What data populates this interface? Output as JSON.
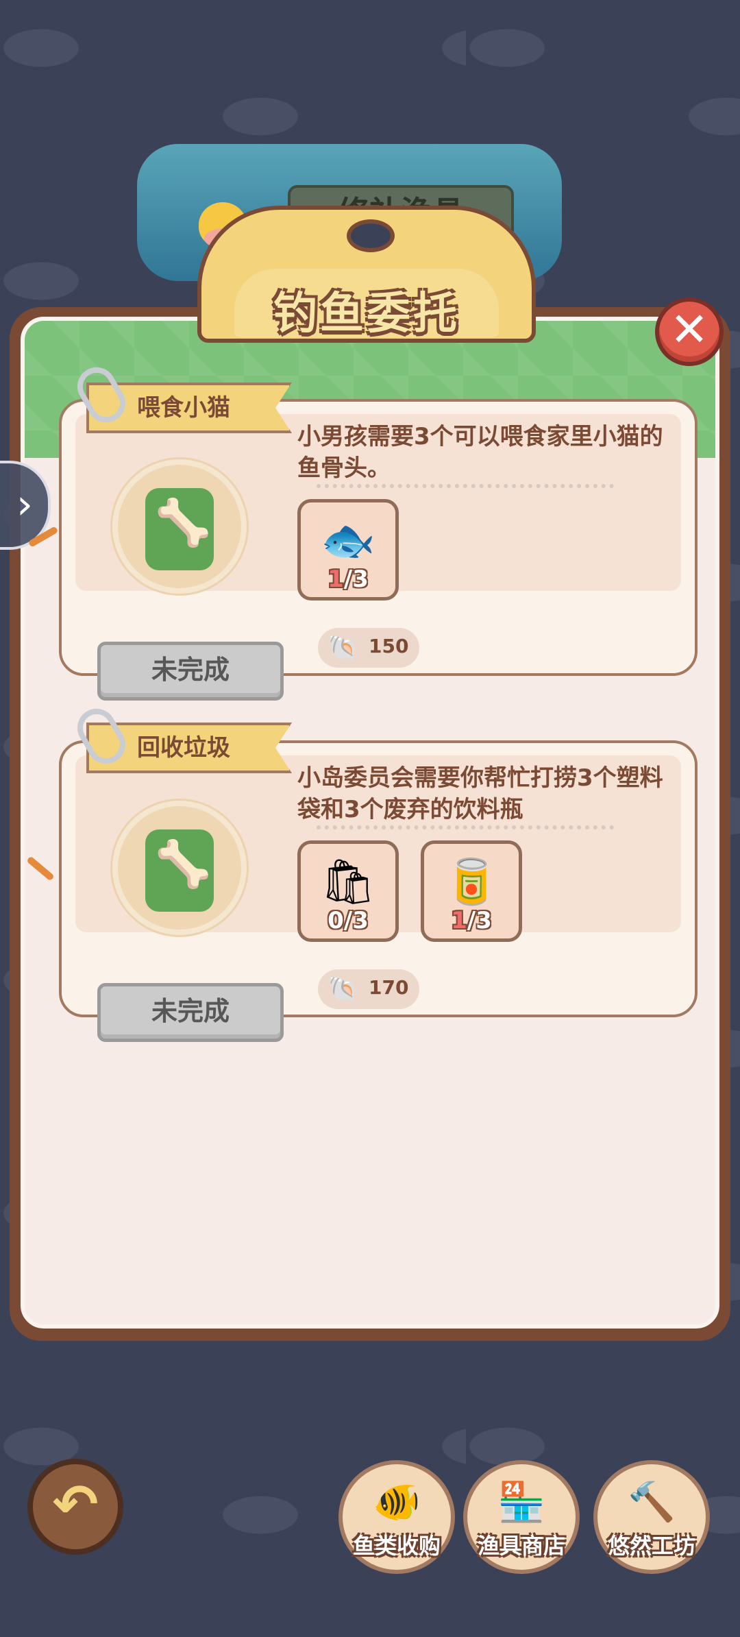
{
  "background": {
    "sign_label": "修补渔具"
  },
  "header": {
    "title": "钓鱼委托"
  },
  "quests": [
    {
      "name": "喂食小猫",
      "description": "小男孩需要3个可以喂食家里小猫的鱼骨头。",
      "items": [
        {
          "icon": "fish-bone-icon",
          "glyph": "🐟",
          "count_current": "1",
          "count_total": "/3"
        }
      ],
      "reward": "150",
      "status": "未完成"
    },
    {
      "name": "回收垃圾",
      "description": "小岛委员会需要你帮忙打捞3个塑料袋和3个废弃的饮料瓶",
      "items": [
        {
          "icon": "plastic-bag-icon",
          "glyph": "🛍",
          "count_current": "0",
          "count_total": "/3"
        },
        {
          "icon": "soda-can-icon",
          "glyph": "🥫",
          "count_current": "1",
          "count_total": "/3"
        }
      ],
      "reward": "170",
      "status": "未完成"
    }
  ],
  "nav": {
    "fish_purchase": "鱼类收购",
    "tackle_shop": "渔具商店",
    "leisure_workshop": "悠然工坊"
  },
  "colors": {
    "panel_border": "#7a4a35",
    "panel_bg": "#f6ebe6",
    "header_green": "#7dc27a",
    "ribbon_yellow": "#f3d47c",
    "close_red": "#e25a4b",
    "status_gray": "#cbcbcb",
    "background": "#3b4258"
  }
}
